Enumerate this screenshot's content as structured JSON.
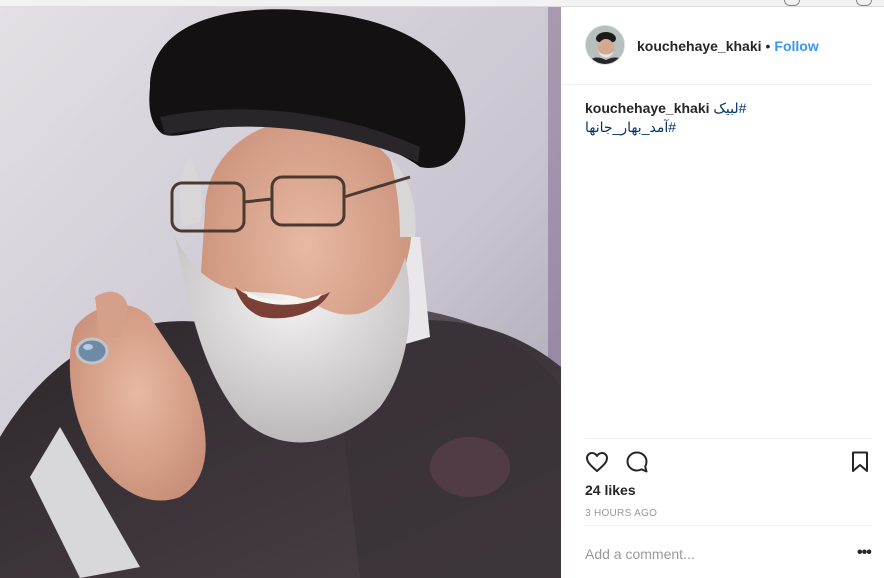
{
  "post": {
    "username": "kouchehaye_khaki",
    "separator": "•",
    "follow_label": "Follow",
    "caption": {
      "username": "kouchehaye_khaki",
      "hashtag_1": "#لبیک",
      "hashtag_2": "#آمد_بهار_جانها"
    },
    "likes": "24 likes",
    "time_ago": "3 HOURS AGO",
    "comment_placeholder": "Add a comment...",
    "more_label": "•••",
    "icons": {
      "like": "heart-icon",
      "comment": "comment-bubble-icon",
      "save": "bookmark-icon",
      "more": "more-options-icon"
    },
    "colors": {
      "link_blue": "#3897f0",
      "hashtag": "#003569",
      "muted": "#999999",
      "text": "#262626",
      "divider": "#efefef"
    }
  }
}
